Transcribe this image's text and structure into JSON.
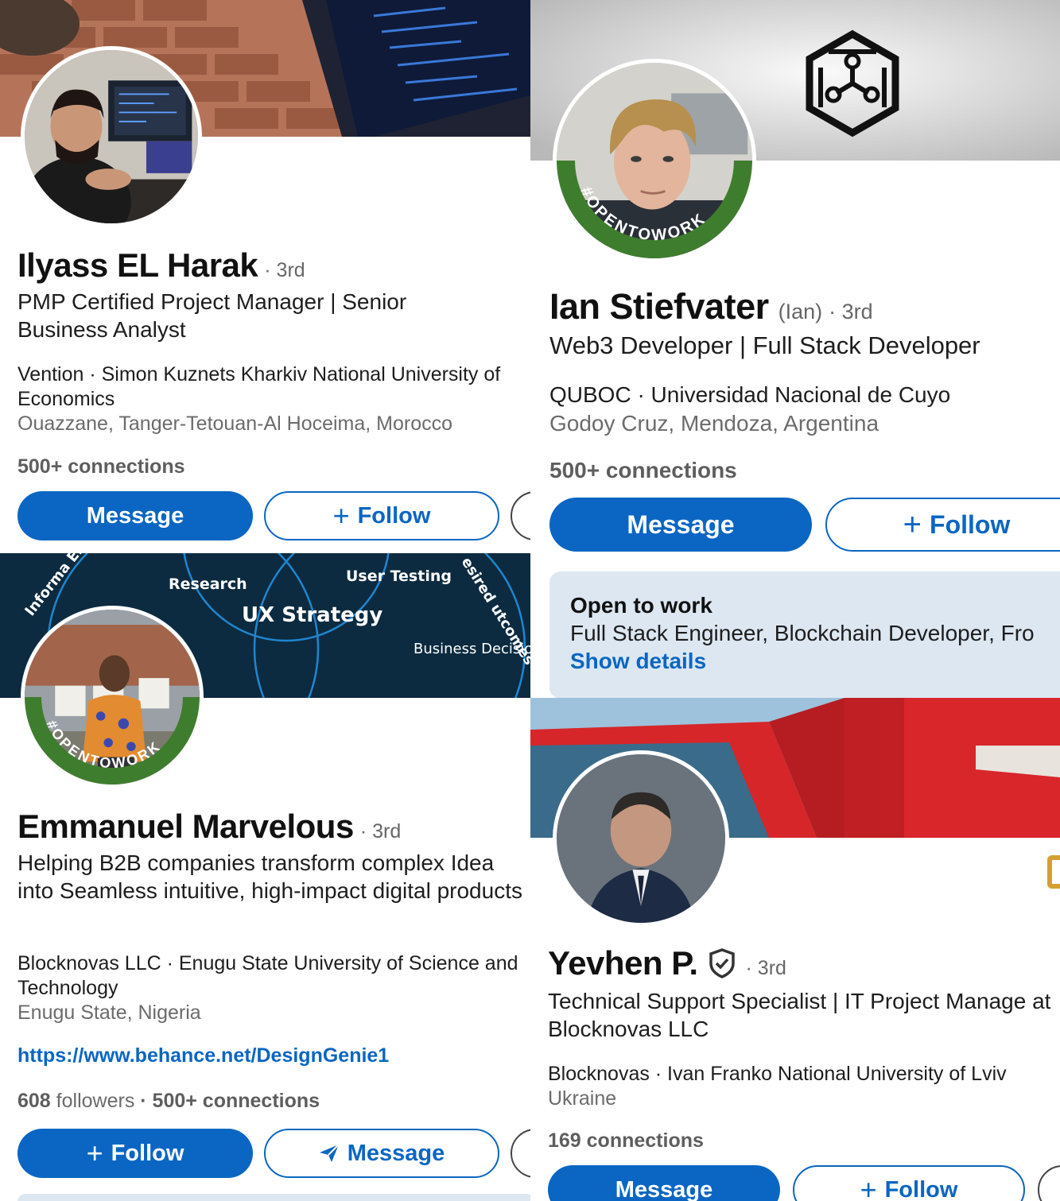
{
  "profiles": [
    {
      "name": "Ilyass EL Harak",
      "degree": "· 3rd",
      "headline": "PMP Certified Project Manager | Senior Business Analyst",
      "education": "Vention · Simon  Kuznets Kharkiv National University of Economics",
      "location": "Ouazzane, Tanger-Tetouan-Al Hoceima, Morocco",
      "connections": "500+ connections",
      "primary_button": "Message",
      "secondary_button": "Follow",
      "more_button": "·"
    },
    {
      "name": "Ian Stiefvater",
      "pronoun": "(Ian)",
      "degree": "· 3rd",
      "headline": "Web3 Developer | Full Stack Developer",
      "education": "QUBOC · Universidad Nacional de Cuyo",
      "location": "Godoy Cruz, Mendoza, Argentina",
      "connections": "500+ connections",
      "primary_button": "Message",
      "secondary_button": "Follow",
      "open_to_work": {
        "title": "Open to work",
        "roles": "Full Stack Engineer, Blockchain Developer, Fro",
        "link": "Show details"
      },
      "frame_text": "#OPENTOWORK"
    },
    {
      "name": "Emmanuel Marvelous",
      "degree": "· 3rd",
      "headline": "Helping B2B companies transform complex Idea into Seamless intuitive, high-impact digital products",
      "education": "Blocknovas LLC · Enugu State University of Science and Technology",
      "location": "Enugu State, Nigeria",
      "website": "https://www.behance.net/DesignGenie1",
      "followers": "608",
      "followers_label": "followers",
      "connections": "· 500+ connections",
      "primary_button": "Follow",
      "secondary_button": "Message",
      "more_button": "·",
      "frame_text": "#OPENTOWORK",
      "cover_text": {
        "research": "Research",
        "user_testing": "User Testing",
        "ux_strategy": "UX Strategy",
        "business_decisions": "Business Decisions",
        "info_elements": "Informa Elements",
        "desired_outcomes": "esired utcomes"
      }
    },
    {
      "name": "Yevhen P.",
      "degree": "· 3rd",
      "headline": "Technical Support Specialist | IT Project Manage at Blocknovas LLC",
      "education": "Blocknovas · Ivan Franko National University of Lviv",
      "location": "Ukraine",
      "connections": "169 connections",
      "primary_button": "Message",
      "secondary_button": "Follow",
      "more_button": "·"
    }
  ],
  "colors": {
    "accent": "#0a66c2",
    "open_to_work_green": "#3f7d2e",
    "open_to_work_card": "#dde7f1"
  },
  "icons": {
    "verified": "shield-check-icon",
    "plus": "plus-icon",
    "send": "send-icon",
    "more": "more-icon"
  }
}
